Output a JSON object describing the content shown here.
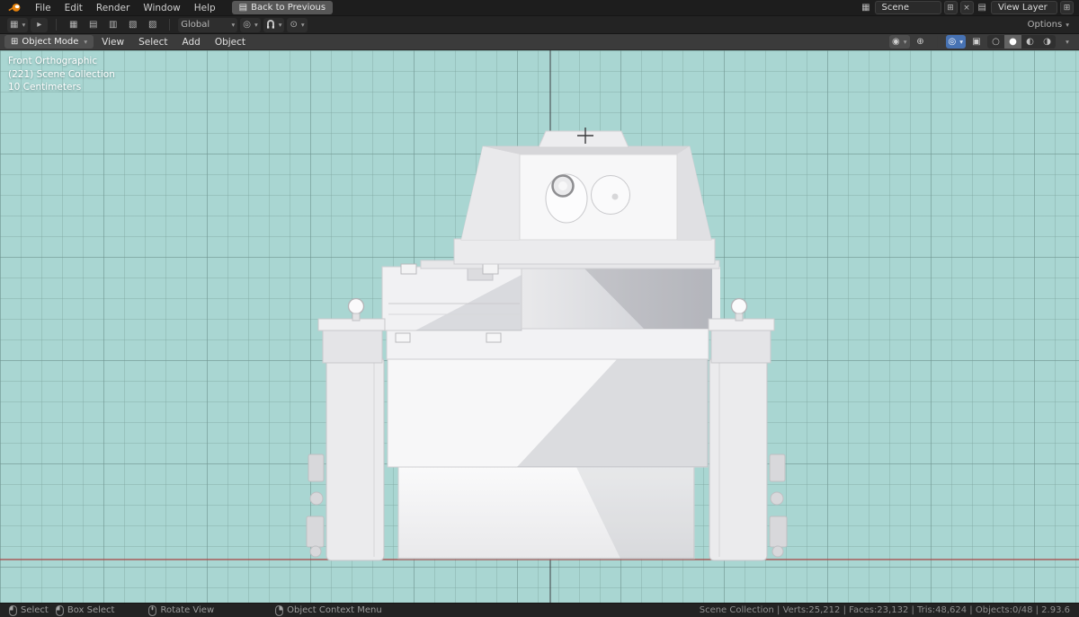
{
  "colors": {
    "accent_blue": "#4772b3",
    "viewport_background": "#a9d6d2",
    "x_axis_red": "#a84848",
    "object_color": "#f2f2f4"
  },
  "icons": {
    "dropdown_arrow": "▾",
    "play": "▸",
    "close": "×",
    "new": "⊞",
    "scene": "▦",
    "view_layer": "▤",
    "keyboard": "▤",
    "editor_type": "▦",
    "pivot": "◎",
    "proportional": "⊙",
    "visibility": "◉",
    "gizmo": "⊕",
    "overlays": "◎",
    "xray": "▣",
    "wireframe": "○",
    "solid": "●",
    "material": "◐",
    "rendered": "◑",
    "mode_icons": [
      "▦",
      "▤",
      "▥",
      "▧",
      "▨"
    ]
  },
  "topbar": {
    "menus": [
      "File",
      "Edit",
      "Render",
      "Window",
      "Help"
    ],
    "back_button": "Back to Previous",
    "scene_label": "Scene",
    "view_layer_label": "View Layer"
  },
  "toolbar": {
    "orientation": "Global",
    "options_label": "Options"
  },
  "viewport_header": {
    "mode": "Object Mode",
    "menus": [
      "View",
      "Select",
      "Add",
      "Object"
    ]
  },
  "viewport": {
    "overlay_lines": [
      "Front Orthographic",
      "(221) Scene Collection",
      "10 Centimeters"
    ]
  },
  "statusbar": {
    "hints": [
      "Select",
      "Box Select",
      "Rotate View",
      "Object Context Menu"
    ],
    "stats": "Scene Collection | Verts:25,212 | Faces:23,132 | Tris:48,624 | Objects:0/48 | 2.93.6"
  }
}
